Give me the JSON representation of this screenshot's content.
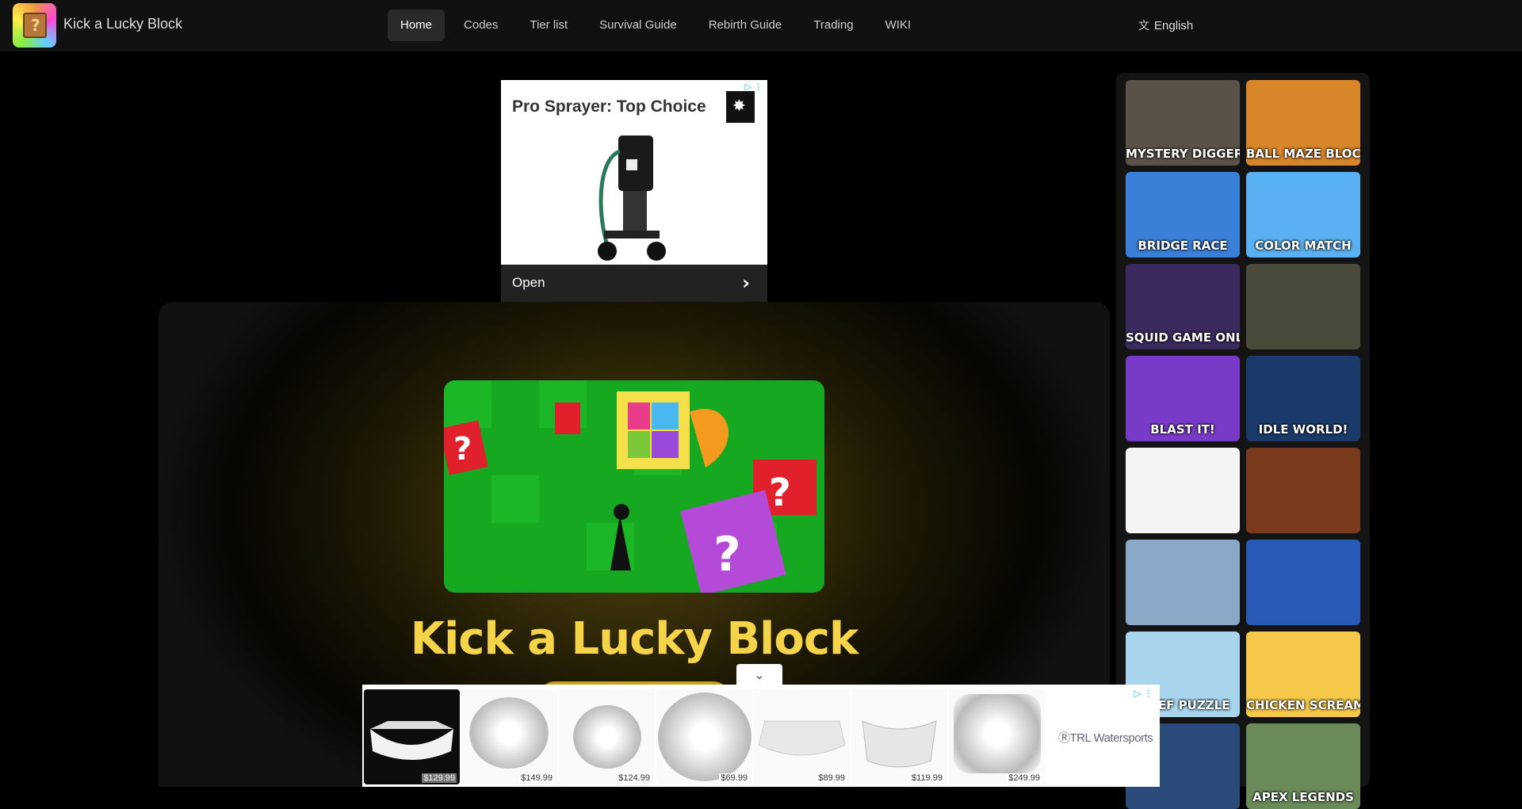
{
  "header": {
    "site_title": "Kick a Lucky Block",
    "nav": [
      {
        "label": "Home",
        "active": true
      },
      {
        "label": "Codes"
      },
      {
        "label": "Tier list"
      },
      {
        "label": "Survival Guide"
      },
      {
        "label": "Rebirth Guide"
      },
      {
        "label": "Trading"
      },
      {
        "label": "WIKI"
      }
    ],
    "language": "English",
    "language_icon": "translate-icon"
  },
  "ad_top": {
    "headline": "Pro Sprayer: Top Choice",
    "cta": "Open",
    "adchoices_icon": "adchoices-icon"
  },
  "hero": {
    "title": "Kick a Lucky Block"
  },
  "sidebar": {
    "games": [
      {
        "label": "MYSTERY DIGGER",
        "bg": "#5a5248"
      },
      {
        "label": "BALL MAZE BLOCK",
        "bg": "#d8862a"
      },
      {
        "label": "BRIDGE RACE",
        "bg": "#3a7fd8"
      },
      {
        "label": "COLOR MATCH",
        "bg": "#5ab0f0"
      },
      {
        "label": "SQUID GAME ONLINE",
        "bg": "#3a2a5e"
      },
      {
        "label": "",
        "bg": "#4a4a3a"
      },
      {
        "label": "BLAST IT!",
        "bg": "#7a3ac8"
      },
      {
        "label": "IDLE WORLD!",
        "bg": "#1a3a6a"
      },
      {
        "label": "",
        "bg": "#f4f4f4"
      },
      {
        "label": "",
        "bg": "#7a3a1e"
      },
      {
        "label": "",
        "bg": "#8aa8c8"
      },
      {
        "label": "",
        "bg": "#2a5ab8"
      },
      {
        "label": "THIEF PUZZLE",
        "bg": "#a8d4ee"
      },
      {
        "label": "CHICKEN SCREAM",
        "bg": "#f6c84a"
      },
      {
        "label": "",
        "bg": "#2a4a7a"
      },
      {
        "label": "APEX LEGENDS",
        "bg": "#6a8a5a"
      }
    ]
  },
  "ad_bottom": {
    "collapse_icon": "chevron-down-icon",
    "products": [
      {
        "price": "$129.99"
      },
      {
        "price": "$149.99"
      },
      {
        "price": "$124.99"
      },
      {
        "price": "$69.99"
      },
      {
        "price": "$89.99"
      },
      {
        "price": "$119.99"
      },
      {
        "price": "$249.99"
      }
    ],
    "brand": "TRL Watersports"
  }
}
